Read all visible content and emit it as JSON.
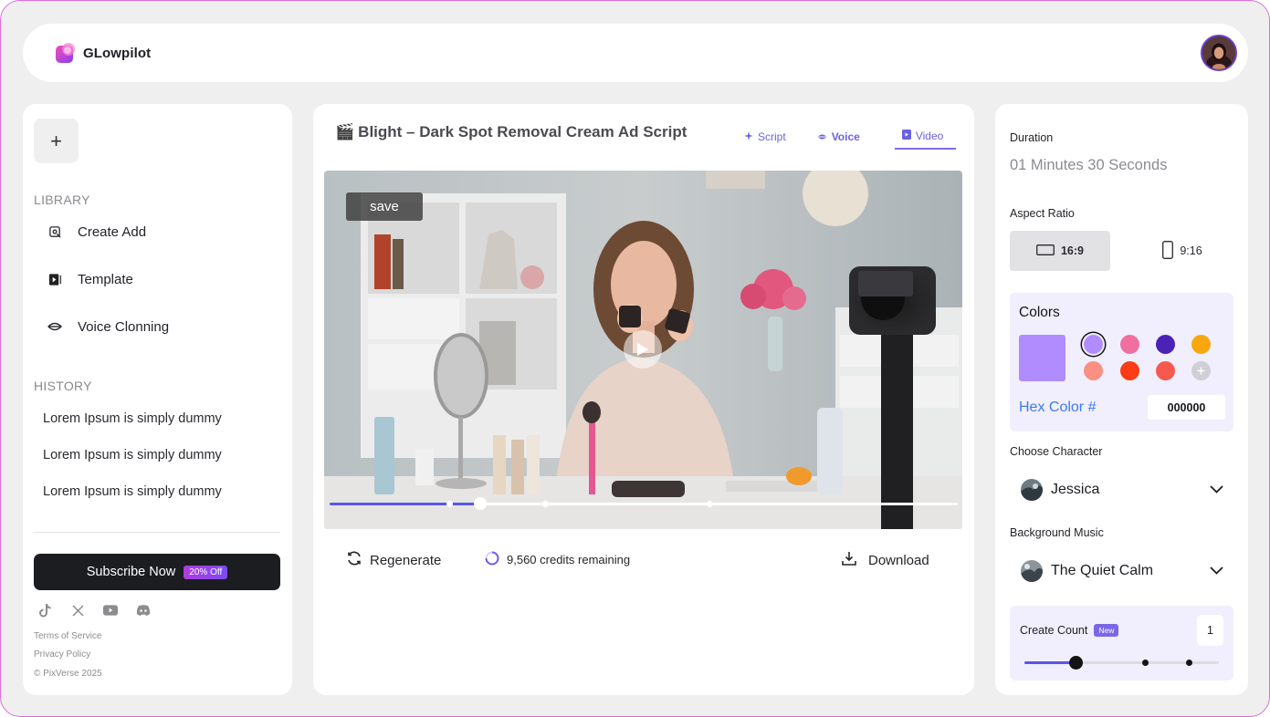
{
  "app": {
    "name": "GLowpilot"
  },
  "sidebar": {
    "new_label": "+",
    "library_label": "LIBRARY",
    "library_items": [
      {
        "label": "Create Add",
        "icon": "create-ad-icon"
      },
      {
        "label": "Template",
        "icon": "template-icon"
      },
      {
        "label": "Voice Clonning",
        "icon": "voice-icon"
      }
    ],
    "history_label": "HISTORY",
    "history_items": [
      {
        "label": "Lorem Ipsum is simply dummy"
      },
      {
        "label": "Lorem Ipsum is simply dummy"
      },
      {
        "label": "Lorem Ipsum is simply dummy"
      }
    ],
    "subscribe_label": "Subscribe Now",
    "subscribe_badge": "20% Off",
    "socials": [
      "tiktok-icon",
      "x-icon",
      "youtube-icon",
      "discord-icon"
    ],
    "terms": "Terms of Service",
    "privacy": "Privacy Policy",
    "copyright": "© PixVerse 2025"
  },
  "editor": {
    "title_emoji": "🎬",
    "title": "Blight – Dark Spot Removal Cream Ad Script",
    "tabs": [
      {
        "label": "Script",
        "icon": "sparkle-icon"
      },
      {
        "label": "Voice",
        "icon": "lips-icon"
      },
      {
        "label": "Video",
        "icon": "video-file-icon"
      }
    ],
    "active_tab": "Video",
    "save_label": "save",
    "playback_progress": 0.24,
    "regenerate_label": "Regenerate",
    "credits_text": "9,560 credits remaining",
    "download_label": "Download"
  },
  "settings": {
    "duration_label": "Duration",
    "duration_value": "01 Minutes 30 Seconds",
    "aspect_label": "Aspect Ratio",
    "aspect_options": [
      {
        "label": "16:9",
        "selected": true
      },
      {
        "label": "9:16",
        "selected": false
      }
    ],
    "colors_title": "Colors",
    "selected_swatch": "#b08cff",
    "palette": [
      "#b08cff",
      "#f06fa0",
      "#4a22b8",
      "#f8a80e",
      "#fa8f82",
      "#fb3c17",
      "#f8594f",
      "#cfcfd6"
    ],
    "hex_label": "Hex Color #",
    "hex_value": "000000",
    "character_label": "Choose Character",
    "character_value": "Jessica",
    "music_label": "Background Music",
    "music_value": "The Quiet Calm",
    "count_label": "Create Count",
    "count_badge": "New",
    "count_value": "1"
  }
}
